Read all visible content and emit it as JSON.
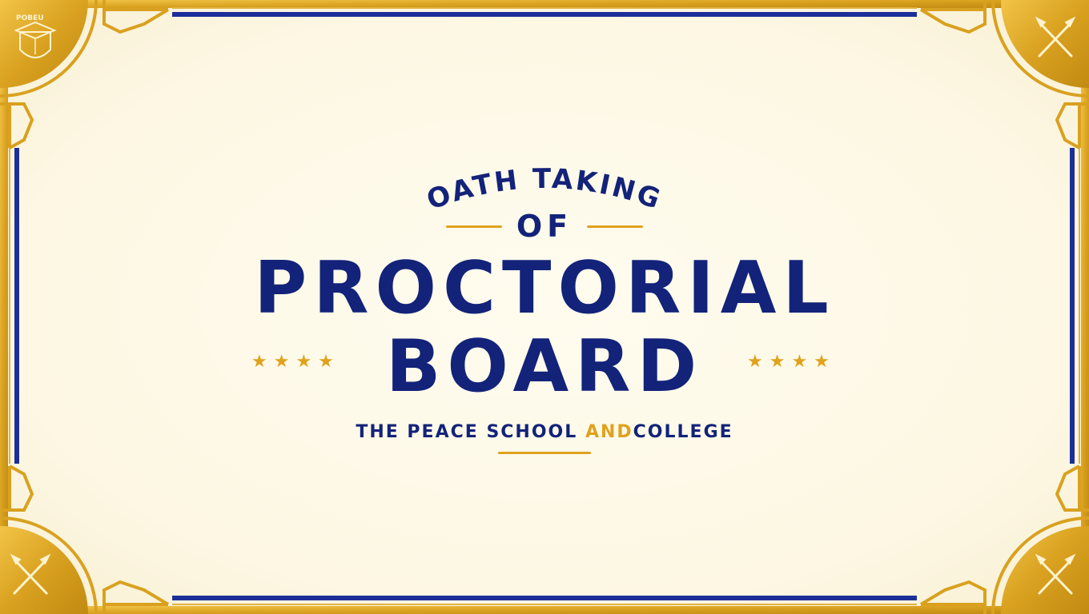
{
  "slide": {
    "arc_heading": "OATH TAKING",
    "connector": "OF",
    "title_line_1": "PROCTORIAL",
    "title_line_2": "BOARD",
    "subtitle_part_1": "THE PEACE SCHOOL",
    "subtitle_accent": "AND",
    "subtitle_part_2": "COLLEGE",
    "star_glyphs": "★★★★",
    "emblem_text": "POBEU"
  },
  "colors": {
    "navy": "#13237a",
    "gold": "#e0a21c",
    "cream": "#fdf8e6"
  },
  "icons": {
    "top_left": "graduation-cap-shield-icon",
    "top_right": "crossed-pens-icon",
    "bottom_left": "crossed-pens-icon",
    "bottom_right": "crossed-pens-icon"
  }
}
